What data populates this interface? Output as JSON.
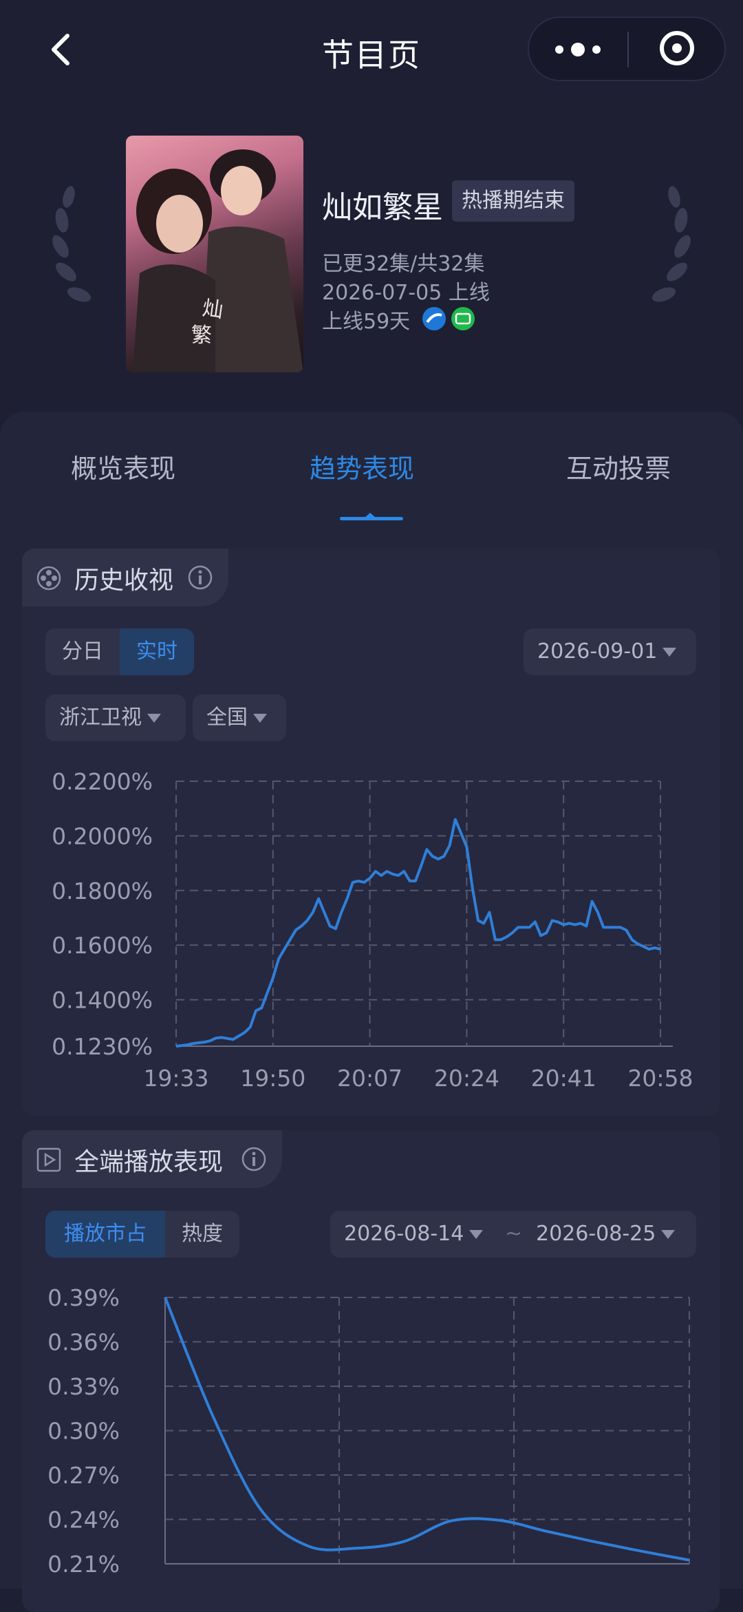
{
  "nav": {
    "title": "节目页"
  },
  "show": {
    "title": "灿如繁星",
    "status_badge": "热播期结束",
    "episodes": "已更32集/共32集",
    "online_date": "2026-07-05 上线",
    "days_online": "上线59天",
    "platform_icons": [
      "zhejiang-tv-icon",
      "iqiyi-icon"
    ]
  },
  "tabs": [
    {
      "label": "概览表现",
      "active": false
    },
    {
      "label": "趋势表现",
      "active": true
    },
    {
      "label": "互动投票",
      "active": false
    }
  ],
  "history": {
    "title": "历史收视",
    "toggle": [
      "分日",
      "实时"
    ],
    "toggle_active": "实时",
    "date": "2026-09-01",
    "channel": "浙江卫视",
    "region": "全国"
  },
  "playback": {
    "title": "全端播放表现",
    "toggle": [
      "播放市占",
      "热度"
    ],
    "toggle_active": "播放市占",
    "date_from": "2026-08-14",
    "range_sep": "~",
    "date_to": "2026-08-25"
  },
  "colors": {
    "accent": "#2d89e6",
    "line": "#2f7fd8",
    "bg": "#1e1f33",
    "card": "#262840"
  },
  "chart_data": [
    {
      "type": "line",
      "x_tick_labels": [
        "19:33",
        "19:50",
        "20:07",
        "20:24",
        "20:41",
        "20:58"
      ],
      "y_tick_labels": [
        "0.2200%",
        "0.2000%",
        "0.1800%",
        "0.1600%",
        "0.1400%",
        "0.1230%"
      ],
      "ylim": [
        0.123,
        0.22
      ],
      "xlim_minutes": [
        0,
        85
      ],
      "grid": true,
      "series": [
        {
          "x": [
            0,
            2,
            3,
            5,
            6,
            7,
            8,
            10,
            12,
            13,
            14,
            15,
            17,
            18,
            20,
            21,
            22,
            23,
            24,
            25,
            26,
            27,
            28,
            29,
            30,
            31,
            32,
            33,
            34,
            35,
            36,
            37,
            38,
            39,
            40,
            41,
            42,
            43,
            44,
            45,
            46,
            47,
            48,
            49,
            50,
            51,
            52,
            53,
            54,
            55,
            56,
            57,
            58,
            59,
            60,
            61,
            62,
            63,
            64,
            65,
            66,
            67,
            68,
            69,
            70,
            71,
            72,
            73,
            74,
            75,
            76,
            77,
            78,
            79,
            80,
            81,
            82,
            83,
            84,
            85
          ],
          "y": [
            0.123,
            0.1235,
            0.124,
            0.1245,
            0.125,
            0.126,
            0.1262,
            0.1255,
            0.128,
            0.13,
            0.136,
            0.137,
            0.148,
            0.155,
            0.162,
            0.1655,
            0.167,
            0.169,
            0.172,
            0.177,
            0.172,
            0.167,
            0.166,
            0.172,
            0.177,
            0.183,
            0.1835,
            0.183,
            0.1845,
            0.187,
            0.1855,
            0.187,
            0.186,
            0.1855,
            0.187,
            0.1835,
            0.1835,
            0.189,
            0.195,
            0.1925,
            0.1915,
            0.1925,
            0.1965,
            0.206,
            0.201,
            0.196,
            0.181,
            0.169,
            0.168,
            0.172,
            0.162,
            0.162,
            0.163,
            0.1645,
            0.1665,
            0.1665,
            0.1665,
            0.1685,
            0.1635,
            0.1645,
            0.169,
            0.1685,
            0.1675,
            0.168,
            0.1675,
            0.168,
            0.167,
            0.176,
            0.172,
            0.1665,
            0.1665,
            0.1665,
            0.1665,
            0.1655,
            0.162,
            0.1605,
            0.1595,
            0.1585,
            0.159,
            0.1585
          ]
        }
      ]
    },
    {
      "type": "line",
      "y_tick_labels": [
        "0.39%",
        "0.36%",
        "0.33%",
        "0.30%",
        "0.27%",
        "0.24%",
        "0.21%"
      ],
      "ylim": [
        0.21,
        0.39
      ],
      "grid": true,
      "series": [
        {
          "x": [
            0,
            1,
            2,
            3,
            4,
            5,
            6,
            7,
            8,
            9,
            10,
            11
          ],
          "y": [
            0.39,
            0.31,
            0.247,
            0.222,
            0.2205,
            0.225,
            0.239,
            0.2395,
            0.232,
            0.225,
            0.2185,
            0.2125
          ]
        }
      ]
    }
  ]
}
